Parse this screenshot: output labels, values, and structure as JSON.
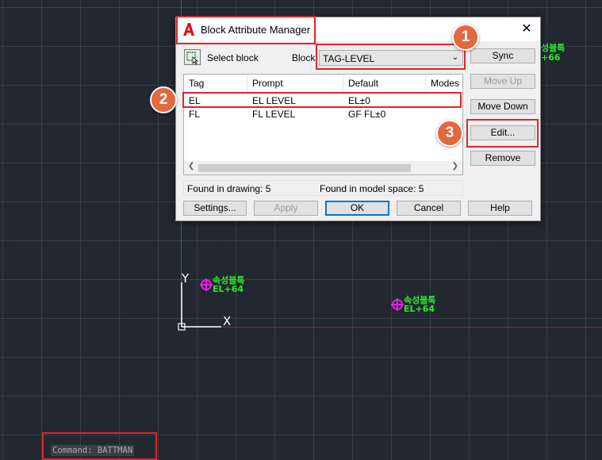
{
  "dialog": {
    "title": "Block Attribute Manager",
    "close_glyph": "✕",
    "select_block_label": "Select block",
    "block_label": "Block:",
    "block_value": "TAG-LEVEL",
    "columns": [
      "Tag",
      "Prompt",
      "Default",
      "Modes"
    ],
    "rows": [
      {
        "tag": "EL",
        "prompt": "EL LEVEL",
        "default": "EL±0"
      },
      {
        "tag": "FL",
        "prompt": "FL LEVEL",
        "default": "GF FL±0"
      }
    ],
    "found_in_drawing": "Found in drawing: 5",
    "found_in_model": "Found in model space: 5",
    "buttons": {
      "sync": "Sync",
      "move_up": "Move Up",
      "move_down": "Move Down",
      "edit": "Edit...",
      "remove": "Remove",
      "settings": "Settings...",
      "apply": "Apply",
      "ok": "OK",
      "cancel": "Cancel",
      "help": "Help"
    }
  },
  "canvas": {
    "ucs_x": "X",
    "ucs_y": "Y",
    "blocks": [
      {
        "line1": "속성블톡",
        "line2": "EL+64"
      },
      {
        "line1": "속성블톡",
        "line2": "EL+64"
      },
      {
        "line1": "성블톡",
        "line2": "+66"
      }
    ]
  },
  "callouts": [
    "1",
    "2",
    "3"
  ],
  "command_line": "Command: BATTMAN",
  "colors": {
    "accent_red": "#e0242c",
    "badge_orange": "#e3673f",
    "attribute_text": "#2dea2d",
    "block_marker": "#e81ee8"
  }
}
